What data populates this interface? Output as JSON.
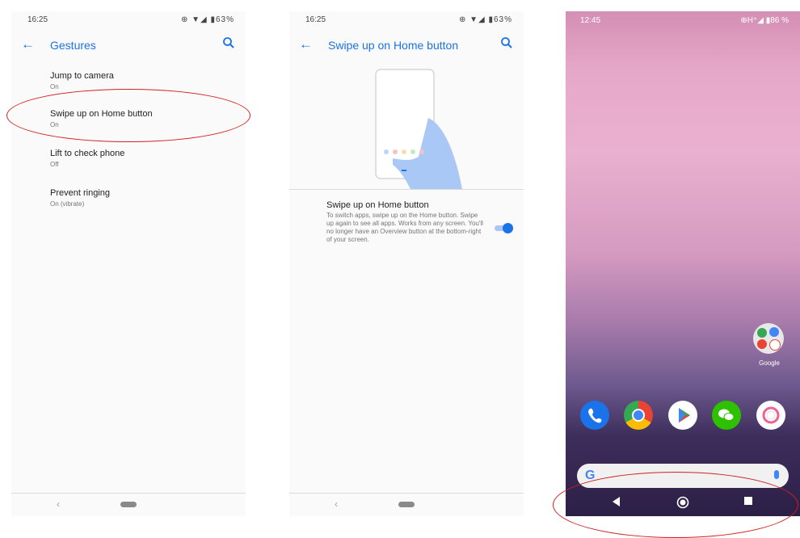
{
  "screen1": {
    "status": {
      "time": "16:25",
      "icons": "⊕ ▼◢ ▮63%"
    },
    "appbar": {
      "title": "Gestures"
    },
    "items": [
      {
        "title": "Jump to camera",
        "subtitle": "On"
      },
      {
        "title": "Swipe up on Home button",
        "subtitle": "On"
      },
      {
        "title": "Lift to check phone",
        "subtitle": "Off"
      },
      {
        "title": "Prevent ringing",
        "subtitle": "On (vibrate)"
      }
    ],
    "nav": {
      "back_glyph": "‹"
    }
  },
  "screen2": {
    "status": {
      "time": "16:25",
      "icons": "⊕ ▼◢ ▮63%"
    },
    "appbar": {
      "title": "Swipe up on Home button"
    },
    "setting": {
      "title": "Swipe up on Home button",
      "description": "To switch apps, swipe up on the Home button. Swipe up again to see all apps. Works from any screen. You'll no longer have an Overview button at the bottom-right of your screen.",
      "toggle_state": "on"
    },
    "nav": {
      "back_glyph": "‹"
    }
  },
  "screen3": {
    "status": {
      "time": "12:45",
      "icons": "⊕H⁺◢ ▮86 %"
    },
    "folder_label": "Google",
    "dock_icons": [
      "phone-icon",
      "chrome-icon",
      "play-store-icon",
      "wechat-icon",
      "camera-icon"
    ],
    "search": {
      "logo": "G"
    },
    "nav": [
      "back-icon",
      "home-icon",
      "recents-icon"
    ]
  },
  "colors": {
    "accent": "#1a73e8",
    "annotation": "#d02020"
  }
}
